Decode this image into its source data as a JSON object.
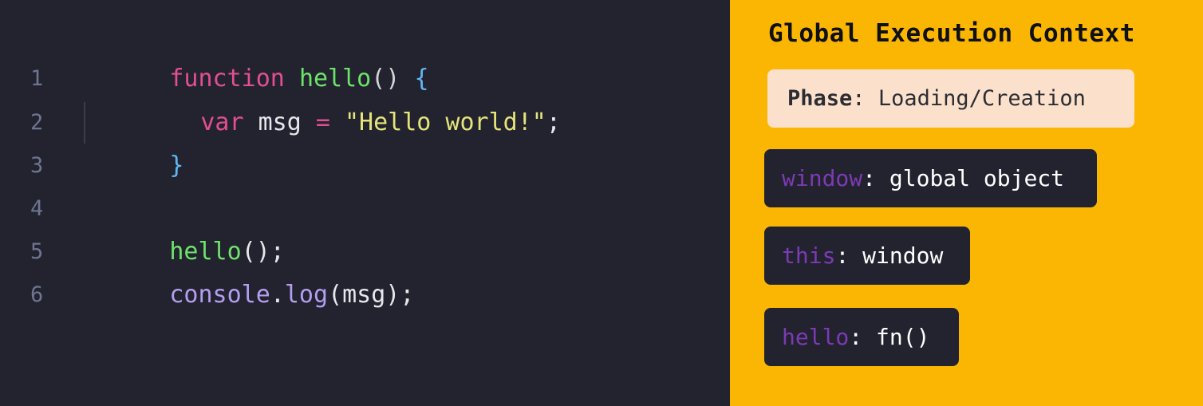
{
  "code": {
    "line_numbers": [
      "1",
      "2",
      "3",
      "4",
      "5",
      "6"
    ],
    "line1": {
      "keyword": "function",
      "name": "hello",
      "parens": "()",
      "brace": "{"
    },
    "line2": {
      "keyword": "var",
      "ident": "msg",
      "op": "=",
      "string": "\"Hello world!\"",
      "semi": ";"
    },
    "line3": {
      "brace": "}"
    },
    "line5": {
      "name": "hello",
      "rest": "();"
    },
    "line6": {
      "obj": "console",
      "dot": ".",
      "method": "log",
      "rest": "(msg);"
    }
  },
  "context": {
    "title": "Global Execution Context",
    "phase": {
      "key": "Phase",
      "sep": ":",
      "value": "Loading/Creation"
    },
    "entries": [
      {
        "key": "window",
        "sep": ":",
        "value": "global object"
      },
      {
        "key": "this",
        "sep": ":",
        "value": "window"
      },
      {
        "key": "hello",
        "sep": ":",
        "value": "fn()"
      }
    ]
  },
  "colors": {
    "editor_bg": "#22232f",
    "context_bg": "#fbb603",
    "phase_bg": "#fbe1cc",
    "keyword": "#e24f93",
    "function": "#6ee36a",
    "string": "#e6e57a",
    "brace": "#60b6f2",
    "context_key": "#7c3ab4"
  }
}
